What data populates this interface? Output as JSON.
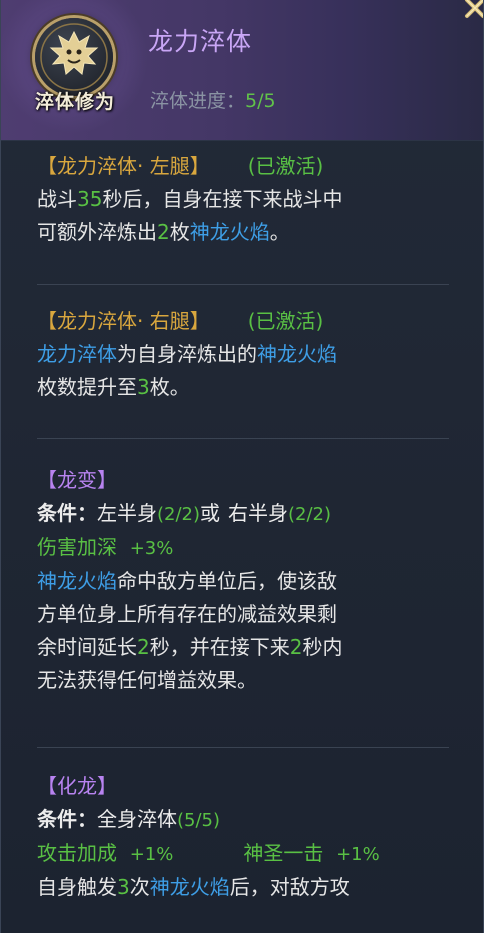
{
  "header": {
    "title": "龙力淬体",
    "emblem_label": "淬体修为",
    "progress_label": "淬体进度：",
    "progress_value": "5/5",
    "emblem_icon": "dragon-head-icon",
    "close_icon": "close-icon"
  },
  "sections": {
    "left_leg": {
      "title": "【龙力淬体· 左腿】",
      "status": "(已激活)",
      "l1_a": "战斗",
      "l1_num": "35",
      "l1_b": "秒后，自身在接下来战斗中",
      "l2_a": "可额外淬炼出",
      "l2_num": "2",
      "l2_b": "枚",
      "l2_skill": "神龙火焰",
      "l2_c": "。"
    },
    "right_leg": {
      "title": "【龙力淬体· 右腿】",
      "status": "(已激活)",
      "l1_skill": "龙力淬体",
      "l1_a": "为自身淬炼出的",
      "l1_skill2": "神龙火焰",
      "l2_a": "枚数提升至",
      "l2_num": "3",
      "l2_b": "枚。"
    },
    "dragon_change": {
      "title": "【龙变】",
      "cond_label": "条件：",
      "cond_a": "左半身",
      "cond_a_val": "(2/2)",
      "cond_or": "或",
      "cond_b": "右半身",
      "cond_b_val": "(2/2)",
      "buff": "伤害加深",
      "buff_val": "+3%",
      "d1_skill": "神龙火焰",
      "d1_a": "命中敌方单位后，使该敌",
      "d2": "方单位身上所有存在的减益效果剩",
      "d3_a": "余时间延长",
      "d3_num": "2",
      "d3_b": "秒，并在接下来",
      "d3_num2": "2",
      "d3_c": "秒内",
      "d4": "无法获得任何增益效果。"
    },
    "dragon_transform": {
      "title": "【化龙】",
      "cond_label": "条件：",
      "cond_a": "全身淬体",
      "cond_a_val": "(5/5)",
      "buff1": "攻击加成",
      "buff1_val": "+1%",
      "buff2": "神圣一击",
      "buff2_val": "+1%",
      "d1_a": "自身触发",
      "d1_num": "3",
      "d1_b": "次",
      "d1_skill": "神龙火焰",
      "d1_c": "后，对敌方攻"
    }
  },
  "colors": {
    "gold": "#d9a73e",
    "green": "#59c044",
    "blue": "#3e9ee6",
    "purple": "#b883f0",
    "header_bg": "#4f3d71"
  }
}
